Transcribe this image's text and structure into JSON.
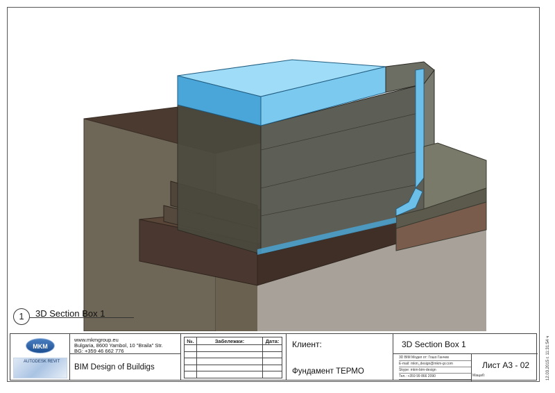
{
  "viewport": {
    "view_number": "1",
    "view_name": "3D Section Box 1"
  },
  "title_block": {
    "logo": {
      "mkm_text": "MKM",
      "revit_text": "AUTODESK REVIT"
    },
    "company": {
      "website": "www.mkmgroup.eu",
      "address": "Bulgaria, 8600 Yambol, 10 \"Braila\" Str.",
      "phone": "BG: +359 46  662 776",
      "brand": "BIM Design of Buildigs"
    },
    "notes": {
      "headers": [
        "№.",
        "Забележки:",
        "Дата:"
      ],
      "rows": 5
    },
    "client": {
      "label": "Клиент:",
      "project": "Фундамент ТЕРМО"
    },
    "sheet": {
      "title": "3D Section Box 1",
      "info_lines": [
        "3D BIM Модел от:   Гошо Ганчев",
        "E-mail: mkm_design@mkm-gr.com",
        "Skype: mkm-bim-design",
        "Тел.: +359 99 866 2090"
      ],
      "number": "Лист А3 - 02",
      "scale_label": "Мащаб:"
    }
  },
  "side_stamp": "12.03.2015 г. 11:31:54 ч",
  "colors": {
    "insulation": "#5fb8e6",
    "concrete": "#6f6c5e",
    "soil": "#6b5a49",
    "footing": "#4d3a30"
  }
}
